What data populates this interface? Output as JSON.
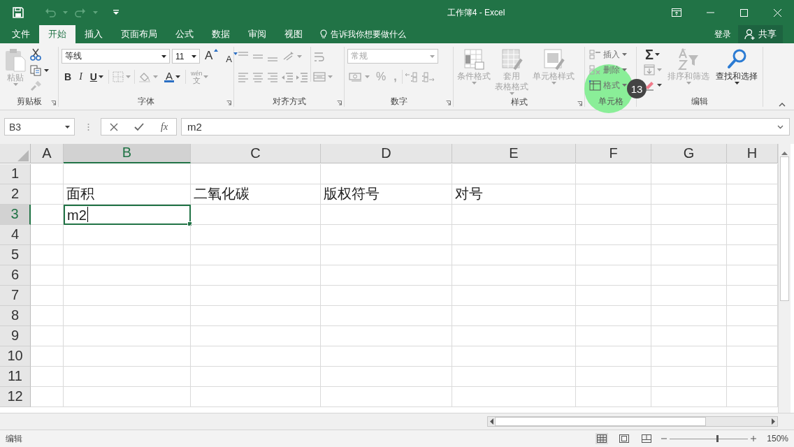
{
  "window": {
    "title": "工作簿4 - Excel"
  },
  "menu_tabs": [
    {
      "label": "文件",
      "selected": false
    },
    {
      "label": "开始",
      "selected": true
    },
    {
      "label": "插入",
      "selected": false
    },
    {
      "label": "页面布局",
      "selected": false
    },
    {
      "label": "公式",
      "selected": false
    },
    {
      "label": "数据",
      "selected": false
    },
    {
      "label": "审阅",
      "selected": false
    },
    {
      "label": "视图",
      "selected": false
    }
  ],
  "tell_me": {
    "placeholder": "告诉我你想要做什么"
  },
  "account": {
    "sign_in": "登录",
    "share": "共享"
  },
  "ribbon": {
    "clipboard": {
      "label": "剪贴板",
      "paste": {
        "label": "粘贴",
        "disabled": true
      }
    },
    "font": {
      "label": "字体",
      "font_name": "等线",
      "font_size": "11",
      "grow": "A",
      "shrink": "A",
      "bold": "B",
      "italic": "I",
      "underline": "U",
      "font_color": "A",
      "phonetic_top": "wén",
      "phonetic_bottom": "文"
    },
    "alignment": {
      "label": "对齐方式"
    },
    "number": {
      "label": "数字",
      "format": "常规",
      "percent": "%",
      "comma": ","
    },
    "styles": {
      "label": "样式",
      "buttons": [
        {
          "lines": [
            "条件格式"
          ],
          "disabled": true
        },
        {
          "lines": [
            "套用",
            "表格格式"
          ],
          "disabled": true
        },
        {
          "lines": [
            "单元格样式"
          ],
          "disabled": true
        }
      ]
    },
    "cells": {
      "label": "单元格",
      "buttons": [
        {
          "label": "插入",
          "disabled": true
        },
        {
          "label": "删除",
          "disabled": true
        },
        {
          "label": "格式",
          "disabled": true
        }
      ]
    },
    "editing": {
      "label": "编辑",
      "autosum": "Σ",
      "buttons": [
        {
          "lines": [
            "排序和筛选"
          ],
          "disabled": true
        },
        {
          "lines": [
            "查找和选择"
          ],
          "disabled": false
        }
      ]
    }
  },
  "click_marker": {
    "step": "13"
  },
  "formula_bar": {
    "name_box": "B3",
    "function_button": "fx",
    "formula": "m2"
  },
  "sheet": {
    "columns": [
      {
        "label": "A",
        "selected": false
      },
      {
        "label": "B",
        "selected": true
      },
      {
        "label": "C",
        "selected": false
      },
      {
        "label": "D",
        "selected": false
      },
      {
        "label": "E",
        "selected": false
      },
      {
        "label": "F",
        "selected": false
      },
      {
        "label": "G",
        "selected": false
      },
      {
        "label": "H",
        "selected": false
      }
    ],
    "rows": [
      {
        "label": "1",
        "selected": false
      },
      {
        "label": "2",
        "selected": false,
        "cells": {
          "B": {
            "text": "面积"
          },
          "C": {
            "text": "二氧化碳"
          },
          "D": {
            "text": "版权符号"
          },
          "E": {
            "text": "对号"
          }
        }
      },
      {
        "label": "3",
        "selected": true,
        "cells": {
          "B": {
            "text": "m2",
            "editing": true
          }
        }
      },
      {
        "label": "4",
        "selected": false
      },
      {
        "label": "5",
        "selected": false
      },
      {
        "label": "6",
        "selected": false
      },
      {
        "label": "7",
        "selected": false
      },
      {
        "label": "8",
        "selected": false
      },
      {
        "label": "9",
        "selected": false
      },
      {
        "label": "10",
        "selected": false
      },
      {
        "label": "11",
        "selected": false
      },
      {
        "label": "12",
        "selected": false
      }
    ]
  },
  "status_bar": {
    "mode": "编辑",
    "views": [
      {
        "selected": true
      },
      {
        "selected": false
      },
      {
        "selected": false
      }
    ],
    "zoom": {
      "level": 0.6,
      "reading": "150%"
    }
  }
}
